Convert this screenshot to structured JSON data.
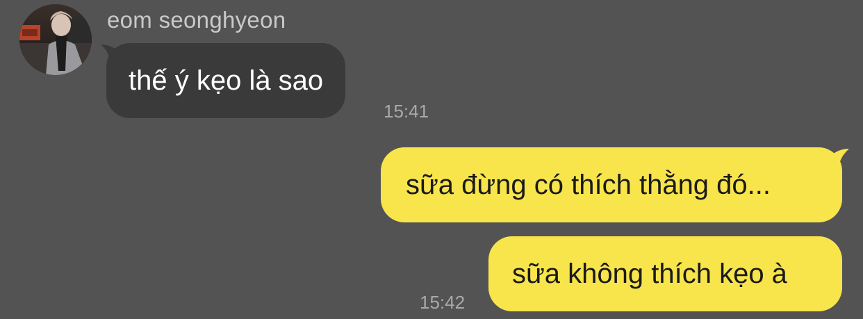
{
  "conversation": {
    "contact": {
      "name": "eom seonghyeon",
      "avatar_icon": "profile-photo"
    },
    "messages": [
      {
        "direction": "incoming",
        "text": "thế ý kẹo là sao",
        "time": "15:41"
      },
      {
        "direction": "outgoing",
        "text": "sữa đừng có thích thằng đó..."
      },
      {
        "direction": "outgoing",
        "text": "sữa không thích kẹo à",
        "time": "15:42"
      }
    ]
  },
  "colors": {
    "background": "#535353",
    "incoming_bubble": "#3a3a3a",
    "outgoing_bubble": "#f8e54b",
    "name_text": "#c9c9c9",
    "time_text": "#a9a9a9"
  }
}
